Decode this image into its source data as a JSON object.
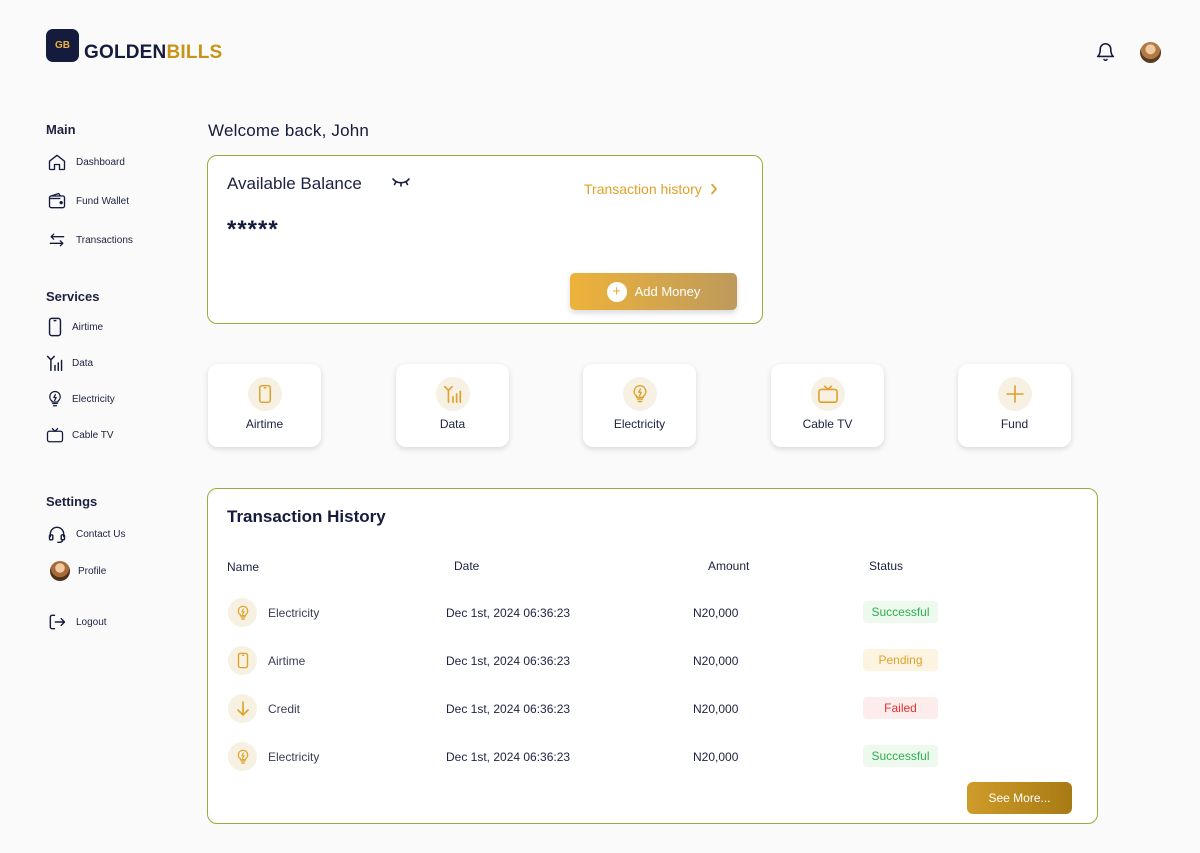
{
  "brand": {
    "logo_text": "GB",
    "name_part1": "GOLDEN",
    "name_part2": "BILLS"
  },
  "header": {
    "notification_icon": "bell-icon",
    "avatar": "user-avatar"
  },
  "sidebar": {
    "sections": [
      {
        "title": "Main",
        "items": [
          {
            "label": "Dashboard",
            "icon": "home-icon"
          },
          {
            "label": "Fund Wallet",
            "icon": "wallet-icon"
          },
          {
            "label": "Transactions",
            "icon": "transfer-arrows-icon"
          }
        ]
      },
      {
        "title": "Services",
        "items": [
          {
            "label": "Airtime",
            "icon": "phone-icon"
          },
          {
            "label": "Data",
            "icon": "signal-icon"
          },
          {
            "label": "Electricity",
            "icon": "bulb-icon"
          },
          {
            "label": "Cable TV",
            "icon": "tv-icon"
          }
        ]
      },
      {
        "title": "Settings",
        "items": [
          {
            "label": "Contact Us",
            "icon": "headset-icon"
          },
          {
            "label": "Profile",
            "icon": "avatar"
          },
          {
            "label": "Logout",
            "icon": "logout-icon"
          }
        ]
      }
    ]
  },
  "welcome": "Welcome back, John",
  "balance": {
    "label": "Available Balance",
    "toggle_icon": "eye-closed-icon",
    "history_link": "Transaction history",
    "value": "*****",
    "add_money": "Add Money"
  },
  "services": [
    {
      "label": "Airtime",
      "icon": "phone-icon"
    },
    {
      "label": "Data",
      "icon": "signal-icon"
    },
    {
      "label": "Electricity",
      "icon": "bulb-icon"
    },
    {
      "label": "Cable TV",
      "icon": "tv-icon"
    },
    {
      "label": "Fund",
      "icon": "plus-icon"
    }
  ],
  "transactions": {
    "title": "Transaction History",
    "columns": [
      "Name",
      "Date",
      "Amount",
      "Status"
    ],
    "rows": [
      {
        "name": "Electricity",
        "icon": "bulb-icon",
        "date": "Dec 1st, 2024 06:36:23",
        "amount": "N20,000",
        "status": "Successful"
      },
      {
        "name": "Airtime",
        "icon": "phone-icon",
        "date": "Dec 1st, 2024 06:36:23",
        "amount": "N20,000",
        "status": "Pending"
      },
      {
        "name": "Credit",
        "icon": "arrow-down-icon",
        "date": "Dec 1st, 2024 06:36:23",
        "amount": "N20,000",
        "status": "Failed"
      },
      {
        "name": "Electricity",
        "icon": "bulb-icon",
        "date": "Dec 1st, 2024 06:36:23",
        "amount": "N20,000",
        "status": "Successful"
      }
    ],
    "see_more": "See More..."
  },
  "colors": {
    "navy": "#141b3c",
    "gold": "#e0a02a",
    "card_border": "#9bab3c",
    "success_text": "#2cb14a",
    "success_bg": "#edf9ef",
    "pending_text": "#e0a02a",
    "pending_bg": "#fdf3e1",
    "failed_text": "#e0342f",
    "failed_bg": "#fdecec"
  }
}
